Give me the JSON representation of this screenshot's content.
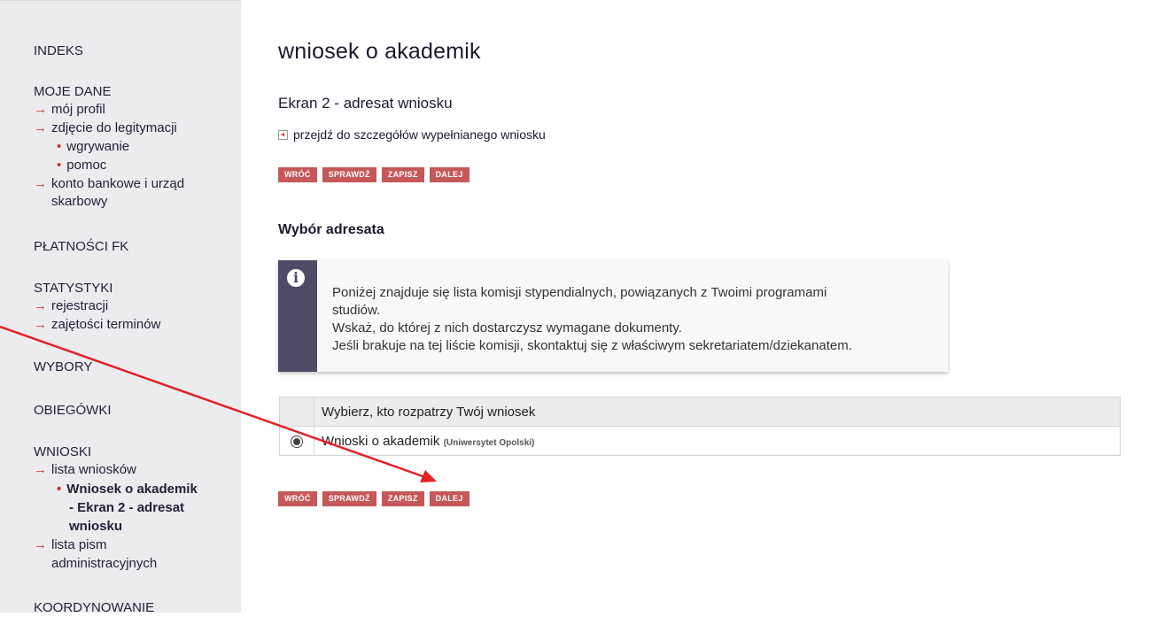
{
  "sidebar": {
    "indeks": "INDEKS",
    "moje_dane": "MOJE DANE",
    "moj_profil": "mój profil",
    "zdjecie": "zdjęcie do legitymacji",
    "wgrywanie": "wgrywanie",
    "pomoc": "pomoc",
    "konto_line1": "konto bankowe i urząd",
    "konto_line2": "skarbowy",
    "platnosci": "PŁATNOŚCI FK",
    "statystyki": "STATYSTYKI",
    "rejestracji": "rejestracji",
    "zajetosci": "zajętości terminów",
    "wybory": "WYBORY",
    "obiegowki": "OBIEGÓWKI",
    "wnioski": "WNIOSKI",
    "lista_wnioskow": "lista wniosków",
    "current_line1": "Wniosek o akademik",
    "current_line2": "- Ekran 2 - adresat",
    "current_line3": "wniosku",
    "lista_pism_line1": "lista pism",
    "lista_pism_line2": "administracyjnych",
    "koordynowanie": "KOORDYNOWANIE"
  },
  "main": {
    "title": "wniosek o akademik",
    "screen_title": "Ekran 2 - adresat wniosku",
    "details_link": "przejdź do szczegółów wypełnianego wniosku",
    "buttons": {
      "back": "WRÓĆ",
      "check": "SPRAWDŹ",
      "save": "ZAPISZ",
      "next": "DALEJ"
    },
    "section_heading": "Wybór adresata",
    "info": {
      "line1": "Poniżej znajduje się lista komisji stypendialnych, powiązanych z Twoimi programami",
      "line2": "studiów.",
      "line3": "Wskaż, do której z nich dostarczysz wymagane dokumenty.",
      "line4": "Jeśli brakuje na tej liście komisji, skontaktuj się z właściwym sekretariatem/dziekanatem."
    },
    "table": {
      "header": "Wybierz, kto rozpatrzy Twój wniosek",
      "option_label": "Wnioski o akademik",
      "option_org": "(Uniwersytet Opolski)"
    }
  },
  "colors": {
    "sidebar_bg": "#ececee",
    "button": "#c65859",
    "accent_arrow": "#e32026",
    "info_strip": "#4f4b66"
  }
}
